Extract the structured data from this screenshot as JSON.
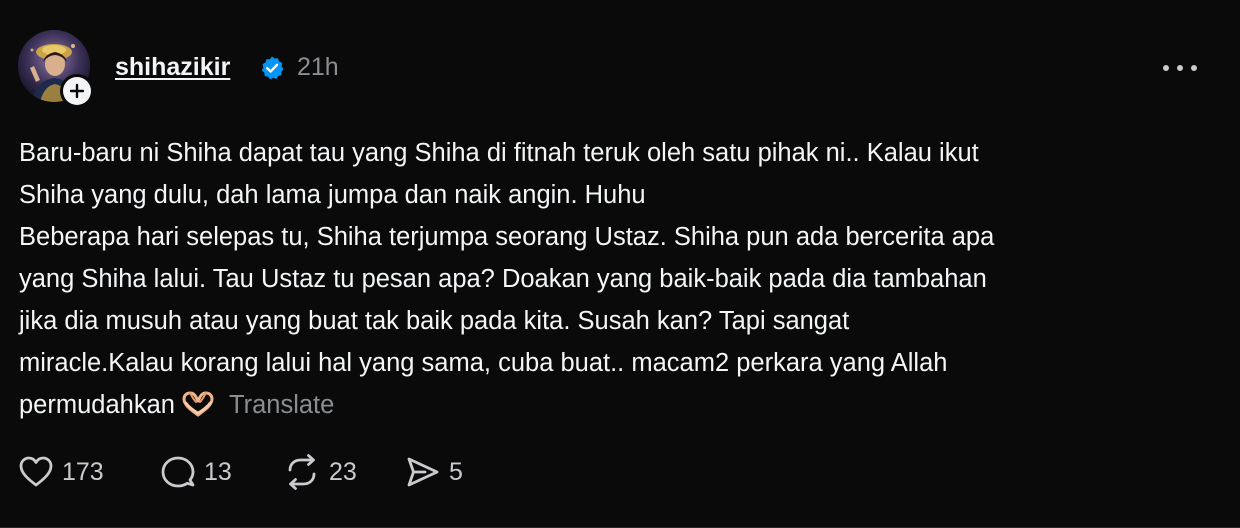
{
  "post": {
    "author": {
      "username": "shihazikir",
      "verified": true,
      "timestamp": "21h"
    },
    "text_lines": [
      "Baru-baru ni Shiha dapat tau yang Shiha di fitnah teruk oleh satu pihak ni.. Kalau ikut",
      "Shiha yang dulu, dah lama jumpa dan naik angin. Huhu",
      "Beberapa hari selepas tu, Shiha terjumpa seorang Ustaz. Shiha pun ada bercerita apa",
      "yang Shiha lalui. Tau Ustaz tu pesan apa? Doakan yang baik-baik pada dia tambahan",
      "jika dia musuh atau yang buat tak baik pada kita. Susah kan? Tapi sangat",
      "miracle.Kalau korang lalui hal yang sama, cuba buat.. macam2 perkara yang Allah",
      "permudahkan"
    ],
    "emoji": "heart-hands",
    "translate_label": "Translate",
    "actions": {
      "like_count": "173",
      "reply_count": "13",
      "repost_count": "23",
      "share_count": "5"
    }
  },
  "icons": {
    "verified_badge": "verified-badge-icon",
    "more": "more-horizontal-icon",
    "follow": "plus-icon",
    "like": "heart-icon",
    "reply": "speech-bubble-icon",
    "repost": "repost-icon",
    "share": "paper-plane-icon"
  },
  "colors": {
    "background": "#0a0a0a",
    "primary_text": "#f3f5f7",
    "secondary_text": "#8a8d91",
    "verified_blue": "#0095f6"
  }
}
